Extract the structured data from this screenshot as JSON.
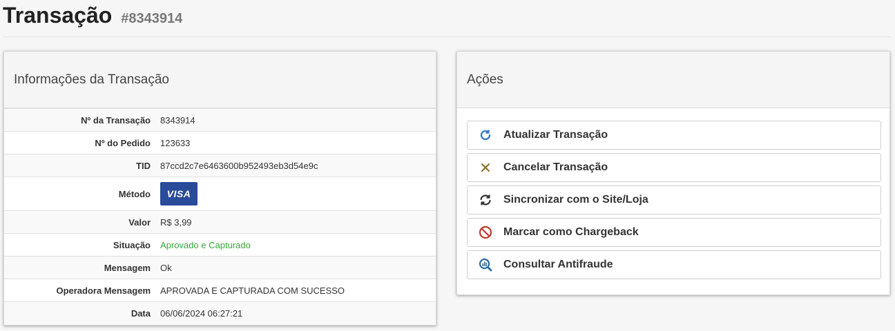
{
  "header": {
    "title": "Transação",
    "transaction_id": "#8343914"
  },
  "info_panel": {
    "title": "Informações da Transação",
    "rows": [
      {
        "label": "Nº da Transação",
        "value": "8343914"
      },
      {
        "label": "Nº do Pedido",
        "value": "123633"
      },
      {
        "label": "TID",
        "value": "87ccd2c7e6463600b952493eb3d54e9c"
      },
      {
        "label": "Método",
        "value": "VISA"
      },
      {
        "label": "Valor",
        "value": "R$ 3,99"
      },
      {
        "label": "Situação",
        "value": "Aprovado e Capturado"
      },
      {
        "label": "Mensagem",
        "value": "Ok"
      },
      {
        "label": "Operadora Mensagem",
        "value": "APROVADA E CAPTURADA COM SUCESSO"
      },
      {
        "label": "Data",
        "value": "06/06/2024 06:27:21"
      }
    ],
    "status_color": "#3aa63a",
    "visa_color": "#2a4a9a"
  },
  "actions_panel": {
    "title": "Ações",
    "buttons": [
      {
        "label": "Atualizar Transação",
        "icon": "refresh-icon"
      },
      {
        "label": "Cancelar Transação",
        "icon": "close-icon"
      },
      {
        "label": "Sincronizar com o Site/Loja",
        "icon": "sync-icon"
      },
      {
        "label": "Marcar como Chargeback",
        "icon": "ban-icon"
      },
      {
        "label": "Consultar Antifraude",
        "icon": "search-chart-icon"
      }
    ]
  }
}
